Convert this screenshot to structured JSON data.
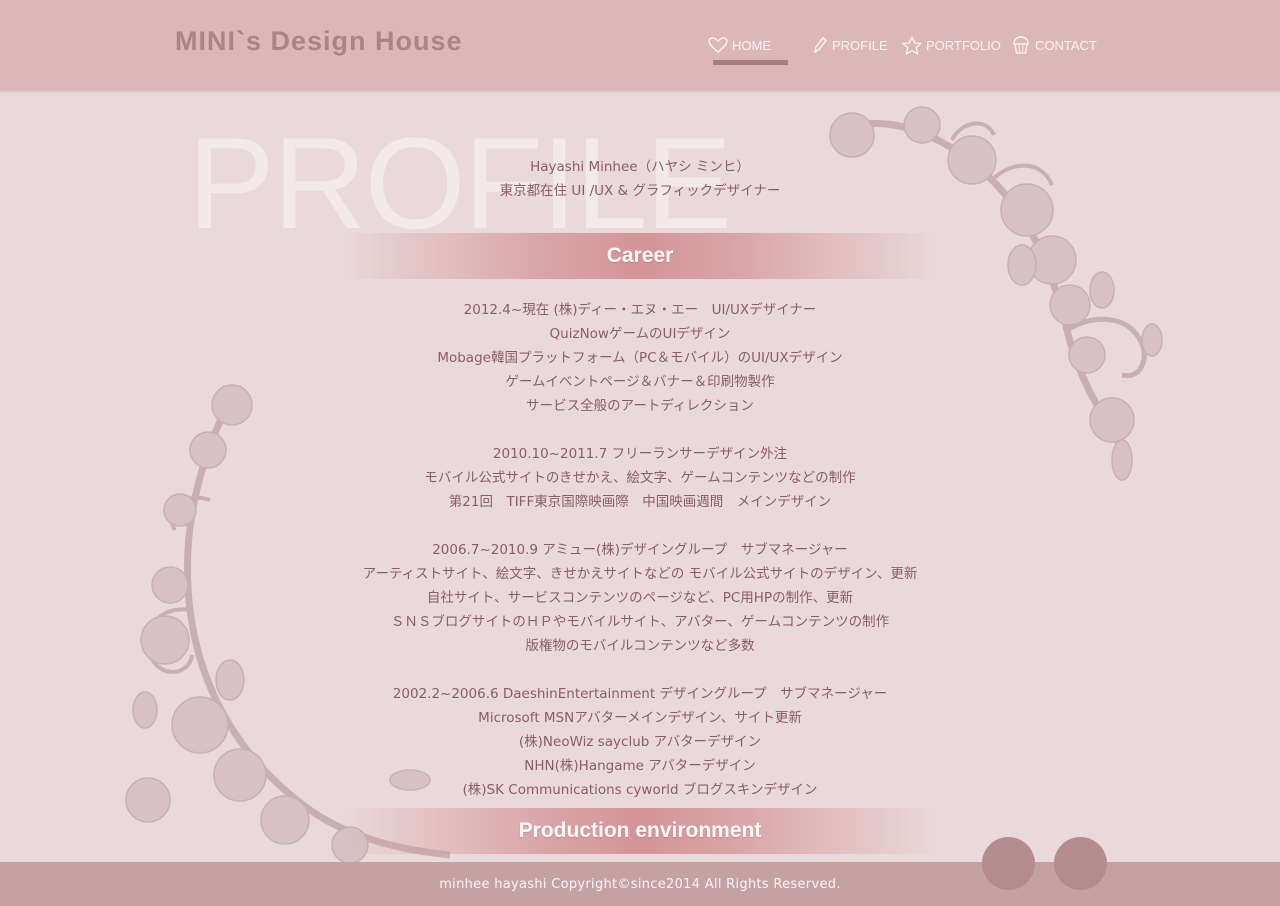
{
  "header": {
    "logo": "MINI`s Design House",
    "nav": [
      {
        "label": "HOME",
        "icon": "heart-icon"
      },
      {
        "label": "PROFILE",
        "icon": "pencil-icon"
      },
      {
        "label": "PORTFOLIO",
        "icon": "star-icon"
      },
      {
        "label": "CONTACT",
        "icon": "cupcake-icon"
      }
    ],
    "active": "HOME"
  },
  "watermark": "PROFILE",
  "intro": {
    "name": "Hayashi Minhee（ハヤシ ミンヒ）",
    "title": "東京都在住  UI /UX & グラフィックデザイナー"
  },
  "sections": {
    "career": "Career",
    "production": "Production environment"
  },
  "career": [
    [
      "2012.4~現在 (株)ディー・エヌ・エー　UI/UXデザイナー",
      "QuizNowゲームのUIデザイン",
      "Mobage韓国プラットフォーム（PC＆モバイル）のUI/UXデザイン",
      "ゲームイベントページ＆バナー＆印刷物製作",
      "サービス全般のアートディレクション"
    ],
    [
      "2010.10~2011.7 フリーランサーデザイン外注",
      "モバイル公式サイトのきせかえ、絵文字、ゲームコンテンツなどの制作",
      "第21回　TIFF東京国際映画際　中国映画週間　メインデザイン"
    ],
    [
      "2006.7~2010.9 アミュー(株)デザイングループ　サブマネージャー",
      "アーティストサイト、絵文字、きせかえサイトなどの モバイル公式サイトのデザイン、更新",
      "自社サイト、サービスコンテンツのページなど、PC用HPの制作、更新",
      "ＳＮＳブログサイトのＨＰやモバイルサイト、アバター、ゲームコンテンツの制作",
      "版権物のモバイルコンテンツなど多数"
    ],
    [
      "2002.2~2006.6 DaeshinEntertainment デザイングループ　サブマネージャー",
      "Microsoft MSNアバターメインデザイン、サイト更新",
      "(株)NeoWiz sayclub アバターデザイン",
      "NHN(株)Hangame アバターデザイン",
      "(株)SK Communications cyworld ブログスキンデザイン"
    ]
  ],
  "footer": {
    "copyright": "minhee hayashi Copyright©since2014 All Rights Reserved."
  },
  "colors": {
    "header_bg": "#dcb7b8",
    "page_bg": "#ead9da",
    "text": "#8a5e62",
    "accent": "#d49498",
    "footer_bg": "#c4a2a3",
    "circle": "#b48c8e"
  }
}
